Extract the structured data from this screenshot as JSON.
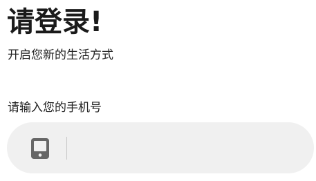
{
  "header": {
    "title": "请登录!",
    "subtitle": "开启您新的生活方式"
  },
  "phone_form": {
    "label": "请输入您的手机号",
    "value": "",
    "placeholder": "",
    "icon": "mobile-phone-icon"
  },
  "colors": {
    "field_background": "#f0f0f0",
    "icon": "#666666",
    "divider": "#c8c8c8",
    "title": "#1a1a1a"
  }
}
